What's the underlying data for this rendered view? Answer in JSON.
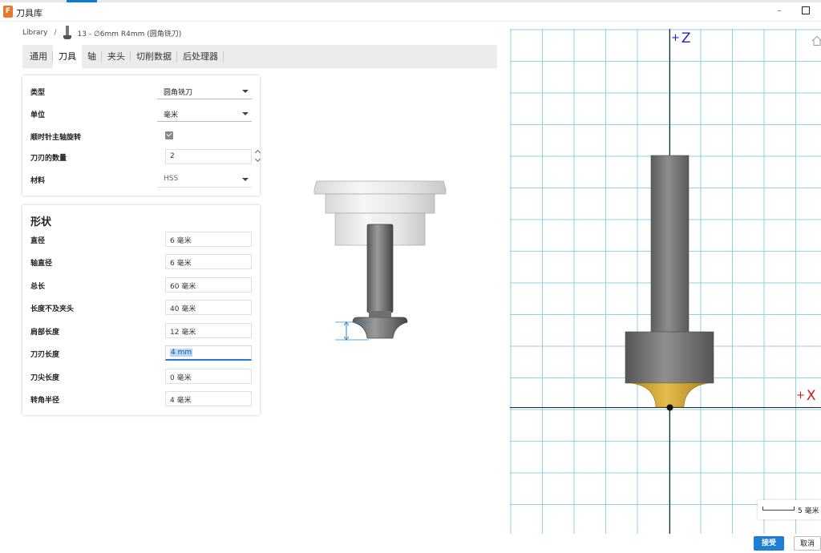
{
  "window": {
    "title": "刀具库",
    "app_icon_letter": "F",
    "accent_color": "#1f7fd6"
  },
  "breadcrumb": {
    "root": "Library",
    "separator": "/",
    "current": "13 - ∅6mm R4mm (圆角铣刀)"
  },
  "tabs": [
    {
      "label": "通用",
      "active": false
    },
    {
      "label": "刀具",
      "active": true
    },
    {
      "label": "轴",
      "active": false
    },
    {
      "label": "夹头",
      "active": false
    },
    {
      "label": "切削数据",
      "active": false
    },
    {
      "label": "后处理器",
      "active": false
    }
  ],
  "tool_props": {
    "type_label": "类型",
    "type_value": "圆角铣刀",
    "unit_label": "单位",
    "unit_value": "毫米",
    "clockwise_label": "顺时针主轴旋转",
    "clockwise_checked": true,
    "flutes_label": "刀刃的数量",
    "flutes_value": "2",
    "material_label": "材料",
    "material_value": "HSS"
  },
  "shape": {
    "title": "形状",
    "fields": [
      {
        "label": "直径",
        "value": "6 毫米"
      },
      {
        "label": "轴直径",
        "value": "6 毫米"
      },
      {
        "label": "总长",
        "value": "60 毫米"
      },
      {
        "label": "长度不及夹头",
        "value": "40 毫米"
      },
      {
        "label": "肩部长度",
        "value": "12 毫米"
      },
      {
        "label": "刀刃长度",
        "value": "4 mm",
        "active": true
      },
      {
        "label": "刀尖长度",
        "value": "0 毫米"
      },
      {
        "label": "转角半径",
        "value": "4 毫米"
      }
    ]
  },
  "viewport": {
    "z_axis": "Z",
    "x_axis": "X",
    "axis_prefix": "+",
    "scale_label": "5 毫米",
    "z_color": "#2020d0",
    "x_color": "#d01818",
    "grid_color": "#8fd1de",
    "home_icon": "home-icon"
  },
  "footer": {
    "accept_label": "接受",
    "cancel_label": "取消"
  }
}
